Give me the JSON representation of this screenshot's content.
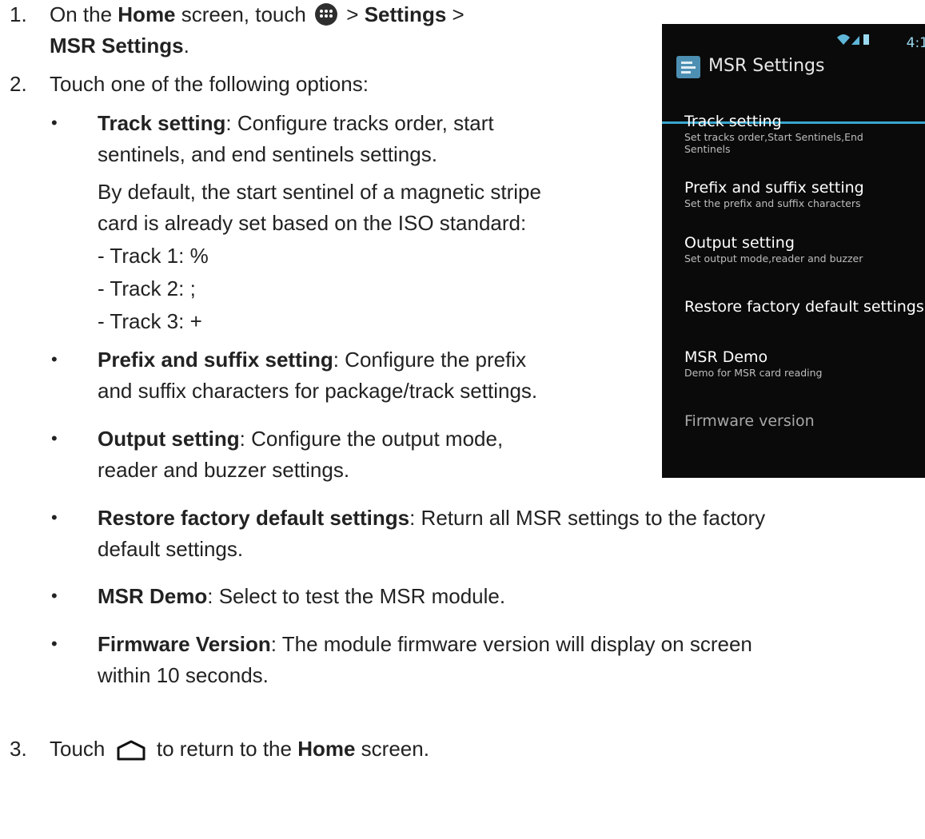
{
  "steps": {
    "s1": {
      "num": "1.",
      "pre": "On the ",
      "home": "Home",
      "mid": " screen, touch",
      "sep1": " > ",
      "settings": "Settings",
      "sep2": " >",
      "msr": "MSR Settings",
      "dot": "."
    },
    "s2": {
      "num": "2.",
      "text": "Touch one of the following options:"
    },
    "s3": {
      "num": "3.",
      "pre": "Touch",
      "mid": "to return to the ",
      "home": "Home",
      "post": " screen."
    }
  },
  "bullet_char": "•",
  "options": [
    {
      "label": "Track setting",
      "desc1": ": Configure tracks order, start",
      "desc2": "sentinels, and end sentinels settings."
    },
    {
      "label": "Prefix and suffix setting",
      "desc1": ": Configure the prefix",
      "desc2": "and suffix characters for package/track settings."
    },
    {
      "label": "Output setting",
      "desc1": ": Configure the output mode,",
      "desc2": "reader and buzzer settings."
    },
    {
      "label": "Restore factory default settings",
      "desc1": ": Return all MSR settings to the factory",
      "desc2": "default settings."
    },
    {
      "label": "MSR Demo",
      "desc1": ": Select to test the MSR module.",
      "desc2": ""
    },
    {
      "label": "Firmware Version",
      "desc1": ": The module firmware version will display on screen",
      "desc2": "within 10 seconds."
    }
  ],
  "track_note": {
    "line1": "By default, the start sentinel of a magnetic stripe",
    "line2": "card is already set based on the ISO standard:",
    "t1": "- Track 1: %",
    "t2": "- Track 2: ;",
    "t3": "- Track 3: +"
  },
  "icons": {
    "apps": "apps-drawer-icon",
    "home": "home-icon"
  },
  "phone": {
    "status_time": "4:1",
    "title": "MSR Settings",
    "accent": "#3aa6cf",
    "items": [
      {
        "title": "Track setting",
        "sub1": "Set tracks order,Start Sentinels,End",
        "sub2": "Sentinels"
      },
      {
        "title": "Prefix and suffix setting",
        "sub1": "Set the prefix and suffix characters",
        "sub2": ""
      },
      {
        "title": "Output setting",
        "sub1": "Set output mode,reader and buzzer",
        "sub2": ""
      },
      {
        "title": "Restore factory default settings",
        "sub1": "",
        "sub2": ""
      },
      {
        "title": "MSR Demo",
        "sub1": "Demo for MSR card reading",
        "sub2": ""
      },
      {
        "title": "Firmware version",
        "sub1": "",
        "sub2": ""
      }
    ]
  }
}
